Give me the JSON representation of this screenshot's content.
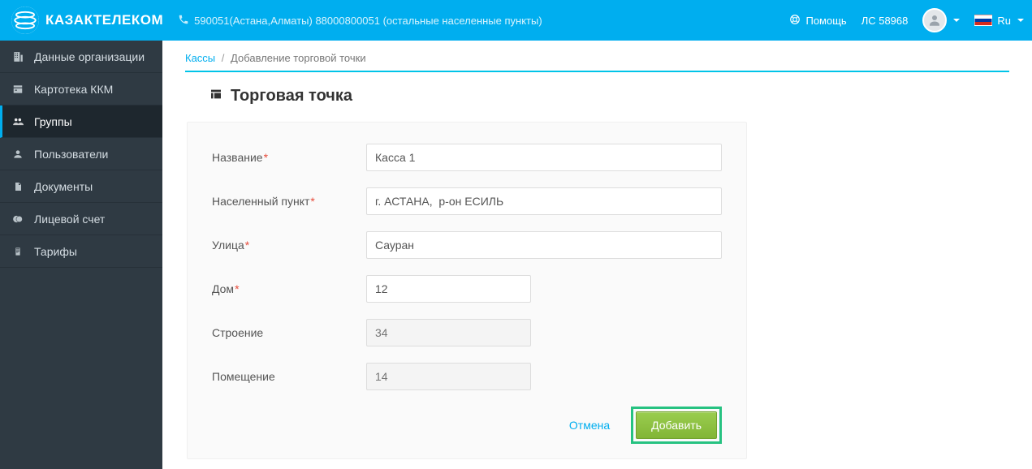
{
  "header": {
    "brand": "КАЗАКТЕЛЕКОМ",
    "phone_text": "590051(Астана,Алматы) 88000800051 (остальные населенные пункты)",
    "help_label": "Помощь",
    "ls_label": "ЛС 58968",
    "lang_label": "Ru"
  },
  "sidebar": {
    "items": [
      {
        "icon": "building-icon",
        "label": "Данные организации"
      },
      {
        "icon": "card-icon",
        "label": "Картотека ККМ"
      },
      {
        "icon": "groups-icon",
        "label": "Группы",
        "active": true
      },
      {
        "icon": "user-icon",
        "label": "Пользователи"
      },
      {
        "icon": "doc-icon",
        "label": "Документы"
      },
      {
        "icon": "wallet-icon",
        "label": "Лицевой счет"
      },
      {
        "icon": "tariff-icon",
        "label": "Тарифы"
      }
    ]
  },
  "breadcrumb": {
    "link_label": "Кассы",
    "current": "Добавление торговой точки"
  },
  "page": {
    "title": "Торговая точка"
  },
  "form": {
    "name_label": "Название",
    "name_value": "Касса 1",
    "city_label": "Населенный пункт",
    "city_value": "г. АСТАНА,  р-он ЕСИЛЬ",
    "street_label": "Улица",
    "street_value": "Сауран",
    "house_label": "Дом",
    "house_value": "12",
    "building_label": "Строение",
    "building_placeholder": "34",
    "room_label": "Помещение",
    "room_placeholder": "14",
    "cancel_label": "Отмена",
    "submit_label": "Добавить"
  }
}
